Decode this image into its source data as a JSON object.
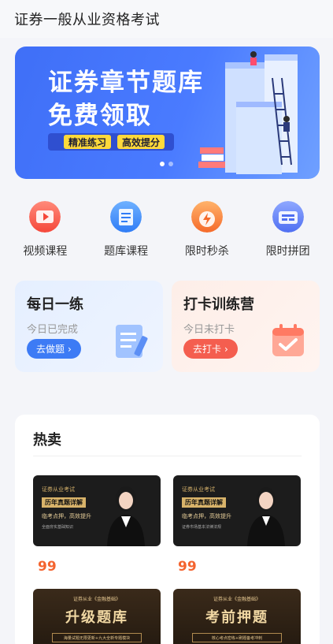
{
  "header": {
    "title": "证券一般从业资格考试"
  },
  "banner": {
    "line1": "证券章节题库",
    "line2": "免费领取",
    "tags": [
      "精准练习",
      "高效提分"
    ]
  },
  "quick_nav": [
    {
      "label": "视频课程",
      "icon": "video-icon"
    },
    {
      "label": "题库课程",
      "icon": "question-bank-icon"
    },
    {
      "label": "限时秒杀",
      "icon": "flash-sale-icon"
    },
    {
      "label": "限时拼团",
      "icon": "group-buy-icon"
    }
  ],
  "practice": {
    "daily": {
      "title": "每日一练",
      "status": "今日已完成",
      "button": "去做题"
    },
    "checkin": {
      "title": "打卡训练营",
      "status": "今日未打卡",
      "button": "去打卡"
    }
  },
  "hot": {
    "title": "热卖",
    "products": [
      {
        "line1": "证券从业考试",
        "line2": "历年真题详解",
        "line3": "临考点押，高效提升",
        "line4": "全面夯实基础知识",
        "price": "99"
      },
      {
        "line1": "证券从业考试",
        "line2": "历年真题详解",
        "line3": "临考点押，高效提升",
        "line4": "证券市场基本法律法规",
        "price": "99"
      },
      {
        "line1": "证券从业《金融基础》",
        "line2": "升级题库",
        "line3": "海量试题无限更新+九大全新专题模块"
      },
      {
        "line1": "证券从业《金融基础》",
        "line2": "考前押题",
        "line3": "核心考点密练+刷题备考冲刺"
      }
    ]
  },
  "colors": {
    "banner_blue": "#4a7bff",
    "tag_yellow": "#ffd93b",
    "price_orange": "#f4642f",
    "daily_button": "#3d7bf5",
    "checkin_button": "#f45e4f"
  }
}
